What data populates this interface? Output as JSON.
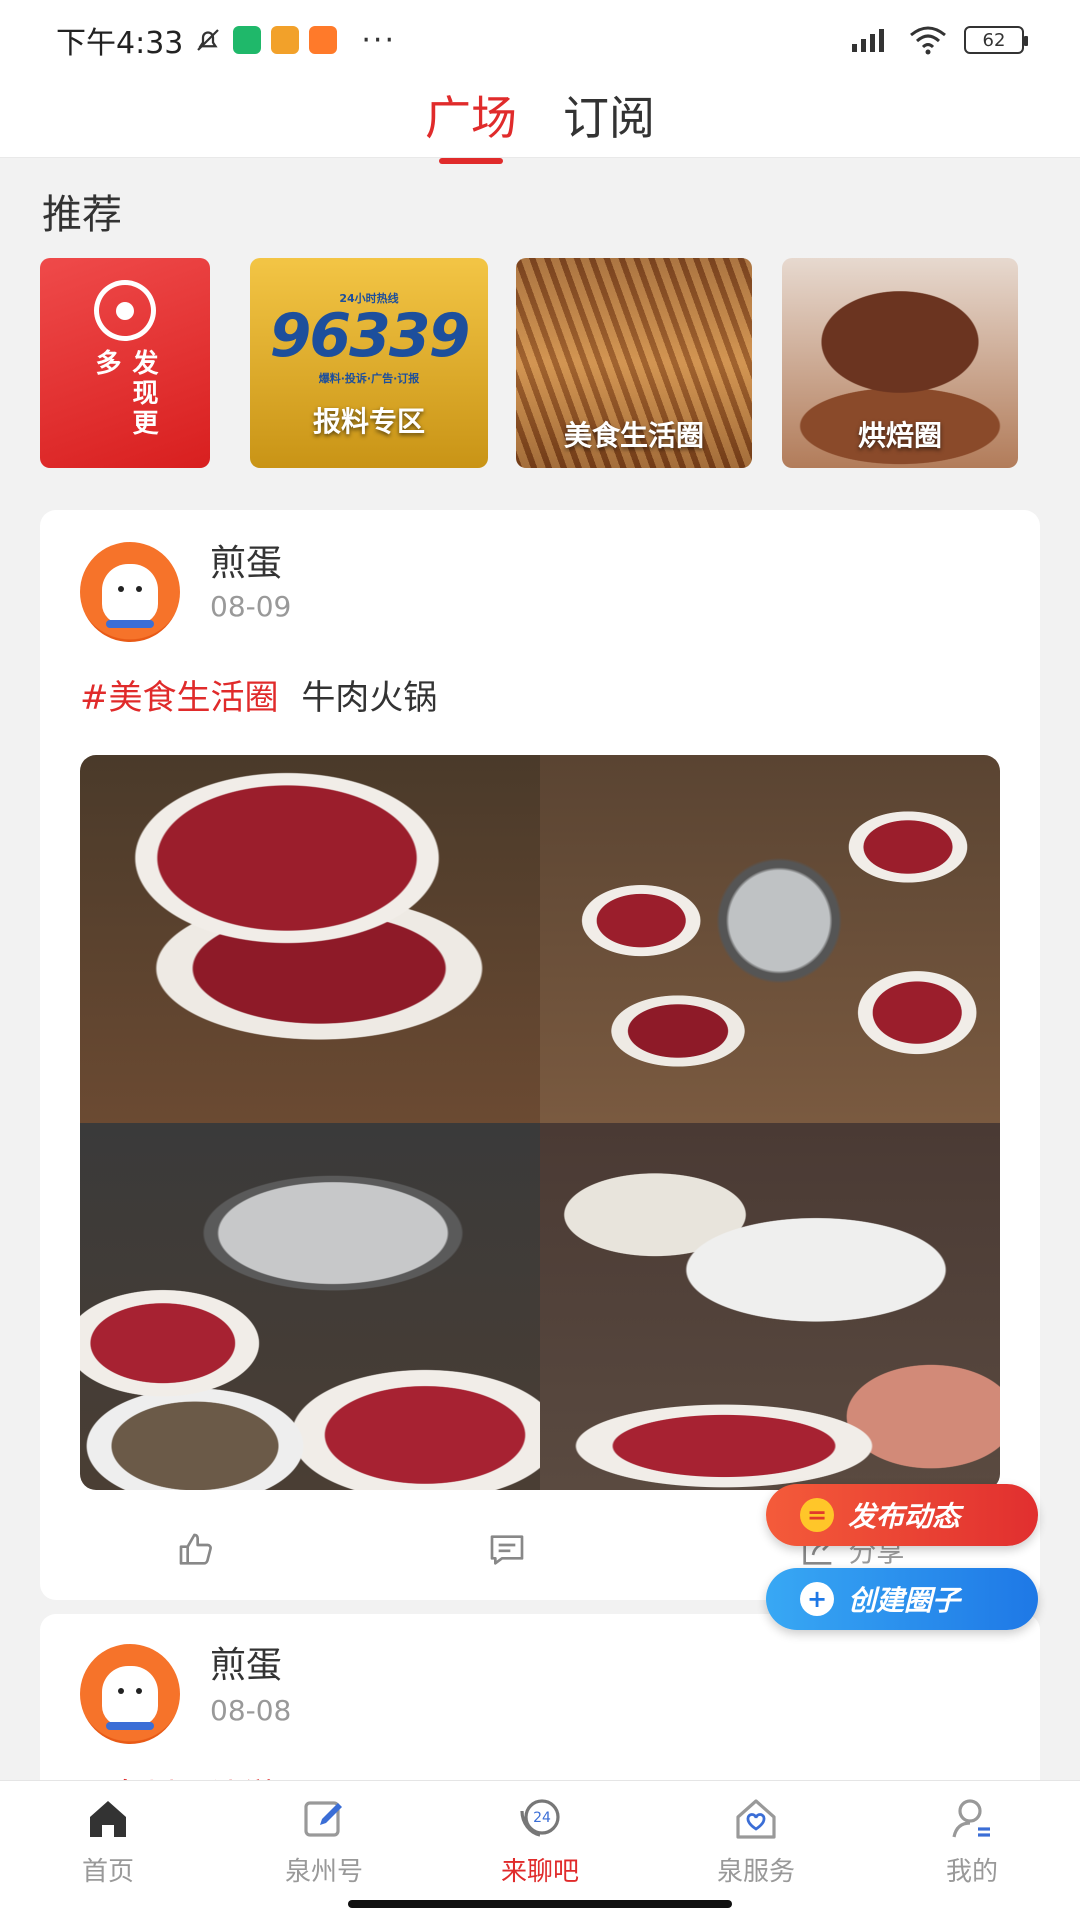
{
  "status_bar": {
    "time": "下午4:33",
    "battery": "62",
    "more": "···"
  },
  "top_tabs": [
    {
      "label": "广场",
      "active": true
    },
    {
      "label": "订阅",
      "active": false
    }
  ],
  "recommend": {
    "title": "推荐",
    "discover_label": "发现更多",
    "items": [
      {
        "label": "报料专区",
        "logo_text": "96339",
        "logo_small": "24小时热线",
        "logo_caption": "爆料·投诉·广告·订报"
      },
      {
        "label": "美食生活圈"
      },
      {
        "label": "烘焙圈"
      }
    ]
  },
  "posts": [
    {
      "username": "煎蛋",
      "date": "08-09",
      "tag": "#美食生活圈",
      "text": "牛肉火锅",
      "actions": {
        "share_label": "分享"
      }
    },
    {
      "username": "煎蛋",
      "date": "08-08",
      "tag_partial": "#泉州周边游记"
    }
  ],
  "fabs": {
    "publish": "发布动态",
    "create": "创建圈子"
  },
  "bottom_nav": [
    {
      "label": "首页",
      "icon": "home-icon",
      "active": false
    },
    {
      "label": "泉州号",
      "icon": "edit-icon",
      "active": false
    },
    {
      "label": "来聊吧",
      "icon": "chat-24-icon",
      "active": true
    },
    {
      "label": "泉服务",
      "icon": "service-house-icon",
      "active": false
    },
    {
      "label": "我的",
      "icon": "profile-icon",
      "active": false
    }
  ],
  "colors": {
    "accent": "#e02b2b",
    "publish_button": "#e12f2f",
    "create_button": "#1e78e6"
  }
}
